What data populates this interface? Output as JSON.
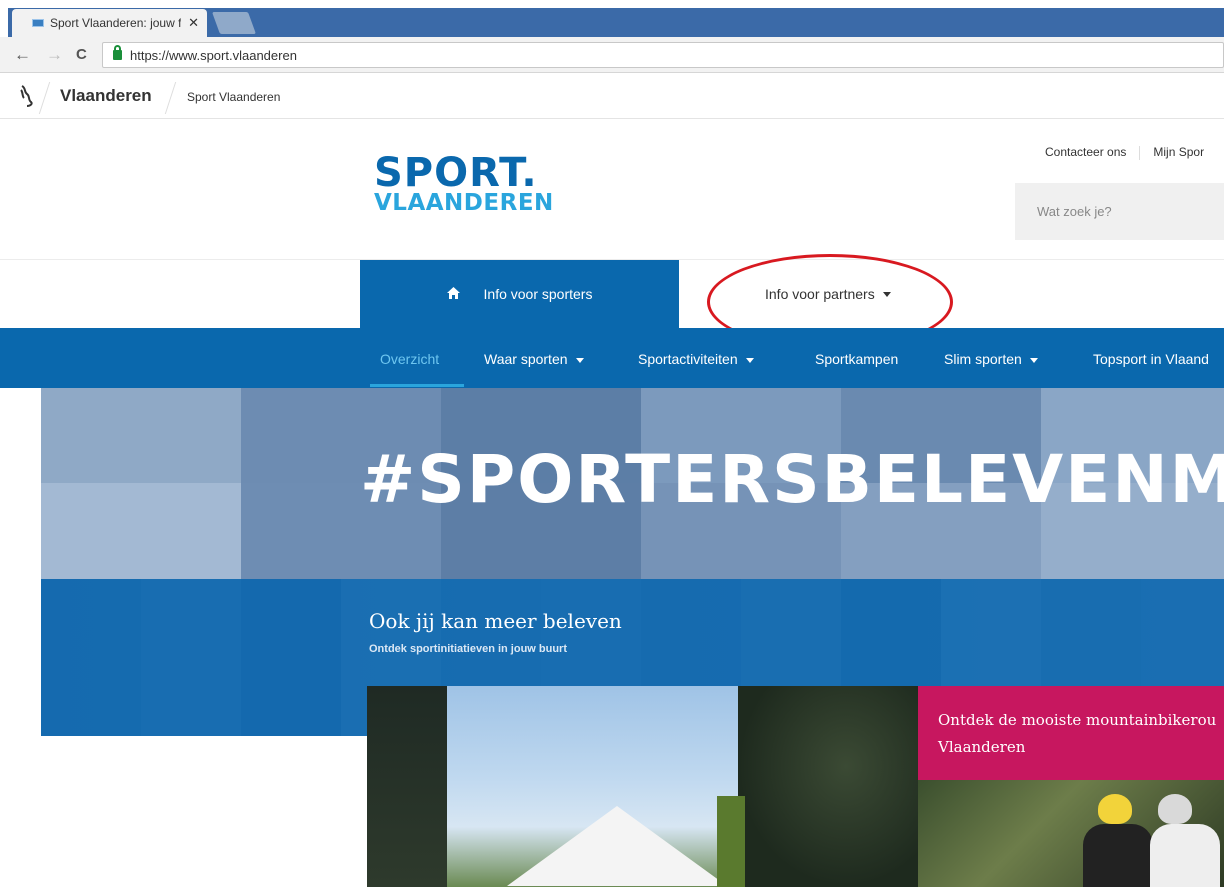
{
  "browser": {
    "tab_title": "Sport Vlaanderen: jouw f",
    "tab_close": "✕",
    "url": "https://www.sport.vlaanderen",
    "back_icon": "←",
    "forward_icon": "→",
    "reload_icon": "C"
  },
  "vl_header": {
    "lion_icon": "🦁",
    "title": "Vlaanderen",
    "subtitle": "Sport Vlaanderen"
  },
  "site_header": {
    "logo_sport": "SPORT",
    "logo_dot": ".",
    "logo_vlaanderen": "VLAANDEREN",
    "contact_link": "Contacteer ons",
    "mijn_link": "Mijn Spor",
    "search_placeholder": "Wat zoek je?"
  },
  "primary_tabs": {
    "home_icon": "🏠",
    "sporters": "Info voor sporters",
    "partners": "Info voor partners"
  },
  "subnav": {
    "items": [
      {
        "label": "Overzicht"
      },
      {
        "label": "Waar sporten"
      },
      {
        "label": "Sportactiviteiten"
      },
      {
        "label": "Sportkampen"
      },
      {
        "label": "Slim sporten"
      },
      {
        "label": "Topsport in Vlaand"
      }
    ]
  },
  "hero": {
    "heading": "#SPORTERSBELEVENME",
    "band_title": "Ook jij kan meer beleven",
    "band_subtitle": "Ontdek sportinitiatieven in jouw buurt"
  },
  "cards": {
    "pink_line1": "Ontdek de mooiste mountainbikerou",
    "pink_line2": "Vlaanderen"
  },
  "colors": {
    "brand_blue": "#0a68ad",
    "light_blue": "#2aa5dd",
    "pink": "#c7175f",
    "annotation_red": "#d81920"
  }
}
